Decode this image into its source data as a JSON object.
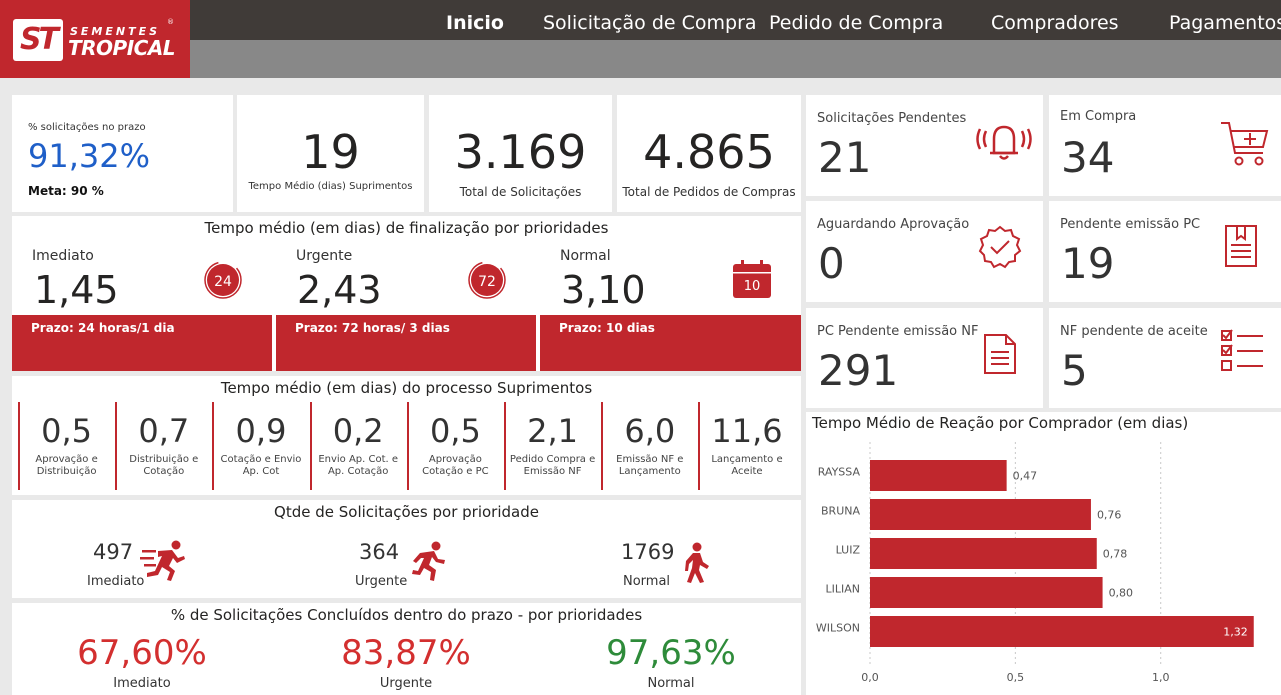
{
  "header": {
    "logo": {
      "mark": "ST",
      "line1": "SEMENTES",
      "line2": "TROPICAL",
      "reg": "®"
    },
    "nav": [
      "Inicio",
      "Solicitação de Compra",
      "Pedido de Compra",
      "Compradores",
      "Pagamentos"
    ],
    "active_nav": "Inicio"
  },
  "kpis": {
    "prazo": {
      "label": "% solicitações no prazo",
      "value": "91,32%",
      "meta": "Meta: 90 %"
    },
    "tempo_medio": {
      "value": "19",
      "label": "Tempo Médio (dias) Suprimentos"
    },
    "total_solicitacoes": {
      "value": "3.169",
      "label": "Total de Solicitações"
    },
    "total_pedidos": {
      "value": "4.865",
      "label": "Total de Pedidos de Compras"
    }
  },
  "prioridades": {
    "title": "Tempo médio (em dias) de finalização por prioridades",
    "items": [
      {
        "name": "Imediato",
        "value": "1,45",
        "badge": "24",
        "prazo": "Prazo: 24 horas/1 dia",
        "icon": "clock-24-icon"
      },
      {
        "name": "Urgente",
        "value": "2,43",
        "badge": "72",
        "prazo": "Prazo: 72 horas/ 3 dias",
        "icon": "clock-72-icon"
      },
      {
        "name": "Normal",
        "value": "3,10",
        "badge": "10",
        "prazo": "Prazo: 10 dias",
        "icon": "calendar-icon"
      }
    ]
  },
  "processo": {
    "title": "Tempo médio (em dias) do processo Suprimentos",
    "steps": [
      {
        "value": "0,5",
        "l1": "Aprovação e",
        "l2": "Distribuição"
      },
      {
        "value": "0,7",
        "l1": "Distribuição e",
        "l2": "Cotação"
      },
      {
        "value": "0,9",
        "l1": "Cotação e Envio",
        "l2": "Ap. Cot"
      },
      {
        "value": "0,2",
        "l1": "Envio Ap. Cot. e",
        "l2": "Ap. Cotação"
      },
      {
        "value": "0,5",
        "l1": "Aprovação",
        "l2": "Cotação e PC"
      },
      {
        "value": "2,1",
        "l1": "Pedido Compra e",
        "l2": "Emissão NF"
      },
      {
        "value": "6,0",
        "l1": "Emissão NF e",
        "l2": "Lançamento"
      },
      {
        "value": "11,6",
        "l1": "Lançamento e",
        "l2": "Aceite"
      }
    ]
  },
  "qtde": {
    "title": "Qtde de Solicitações por prioridade",
    "items": [
      {
        "value": "497",
        "label": "Imediato",
        "icon": "sprinter-icon"
      },
      {
        "value": "364",
        "label": "Urgente",
        "icon": "runner-icon"
      },
      {
        "value": "1769",
        "label": "Normal",
        "icon": "walker-icon"
      }
    ]
  },
  "concluidos": {
    "title": "% de Solicitações Concluídos dentro do prazo - por prioridades",
    "items": [
      {
        "value": "67,60%",
        "label": "Imediato",
        "color": "#d32f2f"
      },
      {
        "value": "83,87%",
        "label": "Urgente",
        "color": "#d32f2f"
      },
      {
        "value": "97,63%",
        "label": "Normal",
        "color": "#2e8b3a"
      }
    ]
  },
  "status": [
    {
      "label": "Solicitações Pendentes",
      "value": "21",
      "icon": "bell-icon"
    },
    {
      "label": "Em Compra",
      "value": "34",
      "icon": "cart-icon"
    },
    {
      "label": "Aguardando Aprovação",
      "value": "0",
      "icon": "badge-check-icon"
    },
    {
      "label": "Pendente emissão PC",
      "value": "19",
      "icon": "document-icon"
    },
    {
      "label": "PC Pendente emissão NF",
      "value": "291",
      "icon": "file-icon"
    },
    {
      "label": "NF pendente de aceite",
      "value": "5",
      "icon": "checklist-icon"
    }
  ],
  "chart_data": {
    "type": "bar",
    "orientation": "horizontal",
    "title": "Tempo Médio de Reação por Comprador (em dias)",
    "categories": [
      "RAYSSA",
      "BRUNA",
      "LUIZ",
      "LILIAN",
      "WILSON"
    ],
    "values": [
      0.47,
      0.76,
      0.78,
      0.8,
      1.32
    ],
    "value_labels": [
      "0,47",
      "0,76",
      "0,78",
      "0,80",
      "1,32"
    ],
    "x_ticks": [
      "0,0",
      "0,5",
      "1,0"
    ],
    "xlim": [
      0,
      1.4
    ],
    "grid": true,
    "color": "#c0272d"
  },
  "colors": {
    "accent": "#c0272d",
    "nav_bg": "#403b38",
    "nav_sub": "#888888",
    "kpi_blue": "#1f5fc8"
  }
}
